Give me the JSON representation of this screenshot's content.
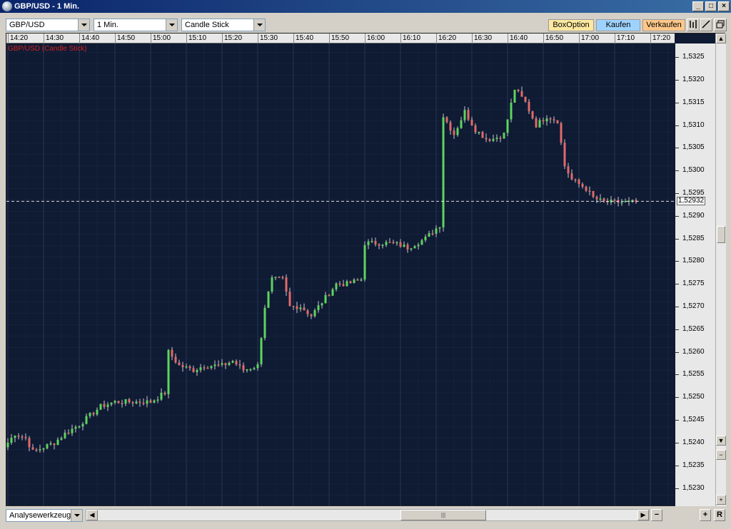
{
  "window": {
    "title": "GBP/USD - 1 Min.",
    "buttons": [
      "_",
      "□",
      "×"
    ]
  },
  "toolbar": {
    "symbol": "GBP/USD",
    "interval": "1 Min.",
    "chart_type": "Candle Stick",
    "boxoption_label": "BoxOption",
    "kaufen_label": "Kaufen",
    "verkaufen_label": "Verkaufen",
    "colors": {
      "boxoption": "#ffe9a0",
      "kaufen": "#9fd3ff",
      "verkaufen": "#ffc88a"
    }
  },
  "chart": {
    "legend": "GBP/USD (Candle Stick)",
    "current_price": "1,52932",
    "colors": {
      "background": "#0f1a33",
      "grid": "#2a3a5a",
      "up": "#5cd65c",
      "down": "#e06a6a",
      "wick": "#c8c8c8",
      "price_line": "#ffffff"
    }
  },
  "chart_data": {
    "type": "candlestick",
    "title": "GBP/USD (Candle Stick)",
    "time_ticks": [
      "14:20",
      "14:30",
      "14:40",
      "14:50",
      "15:00",
      "15:10",
      "15:20",
      "15:30",
      "15:40",
      "15:50",
      "16:00",
      "16:10",
      "16:20",
      "16:30",
      "16:40",
      "16:50",
      "17:00",
      "17:10",
      "17:20"
    ],
    "price_ticks": [
      "1,5325",
      "1,5320",
      "1,5315",
      "1,5310",
      "1,5305",
      "1,5300",
      "1,5295",
      "1,5290",
      "1,5285",
      "1,5280",
      "1,5275",
      "1,5270",
      "1,5265",
      "1,5260",
      "1,5255",
      "1,5250",
      "1,5245",
      "1,5240",
      "1,5235",
      "1,5230"
    ],
    "ylim": [
      1.5226,
      1.5328
    ],
    "current_price": 1.52932,
    "close_path": [
      [
        "14:20",
        1.524
      ],
      [
        "14:22",
        1.5242
      ],
      [
        "14:25",
        1.5241
      ],
      [
        "14:27",
        1.5238
      ],
      [
        "14:30",
        1.5239
      ],
      [
        "14:33",
        1.524
      ],
      [
        "14:36",
        1.5242
      ],
      [
        "14:40",
        1.5244
      ],
      [
        "14:43",
        1.5246
      ],
      [
        "14:46",
        1.5248
      ],
      [
        "14:50",
        1.5249
      ],
      [
        "14:55",
        1.5249
      ],
      [
        "15:00",
        1.5249
      ],
      [
        "15:04",
        1.5251
      ],
      [
        "15:05",
        1.526
      ],
      [
        "15:08",
        1.5257
      ],
      [
        "15:12",
        1.5256
      ],
      [
        "15:15",
        1.5257
      ],
      [
        "15:20",
        1.5257
      ],
      [
        "15:23",
        1.5258
      ],
      [
        "15:26",
        1.5256
      ],
      [
        "15:30",
        1.5257
      ],
      [
        "15:32",
        1.527
      ],
      [
        "15:34",
        1.5276
      ],
      [
        "15:37",
        1.5276
      ],
      [
        "15:39",
        1.527
      ],
      [
        "15:42",
        1.527
      ],
      [
        "15:45",
        1.5268
      ],
      [
        "15:48",
        1.5271
      ],
      [
        "15:52",
        1.5275
      ],
      [
        "15:55",
        1.5275
      ],
      [
        "15:59",
        1.5276
      ],
      [
        "16:00",
        1.5284
      ],
      [
        "16:04",
        1.5284
      ],
      [
        "16:08",
        1.5284
      ],
      [
        "16:12",
        1.5283
      ],
      [
        "16:17",
        1.5285
      ],
      [
        "16:21",
        1.5288
      ],
      [
        "16:22",
        1.5312
      ],
      [
        "16:25",
        1.5308
      ],
      [
        "16:28",
        1.5313
      ],
      [
        "16:31",
        1.5309
      ],
      [
        "16:34",
        1.5307
      ],
      [
        "16:36",
        1.5307
      ],
      [
        "16:39",
        1.5308
      ],
      [
        "16:42",
        1.5318
      ],
      [
        "16:45",
        1.5315
      ],
      [
        "16:48",
        1.531
      ],
      [
        "16:51",
        1.5312
      ],
      [
        "16:54",
        1.5311
      ],
      [
        "16:56",
        1.5301
      ],
      [
        "16:58",
        1.5298
      ],
      [
        "17:02",
        1.5296
      ],
      [
        "17:04",
        1.5294
      ],
      [
        "17:07",
        1.5293
      ],
      [
        "17:10",
        1.5293
      ],
      [
        "17:13",
        1.5293
      ],
      [
        "17:16",
        1.5293
      ]
    ]
  },
  "bottom": {
    "tool_select": "Analysewerkzeug",
    "zoom_out": "−",
    "zoom_in": "+",
    "reset": "R"
  }
}
